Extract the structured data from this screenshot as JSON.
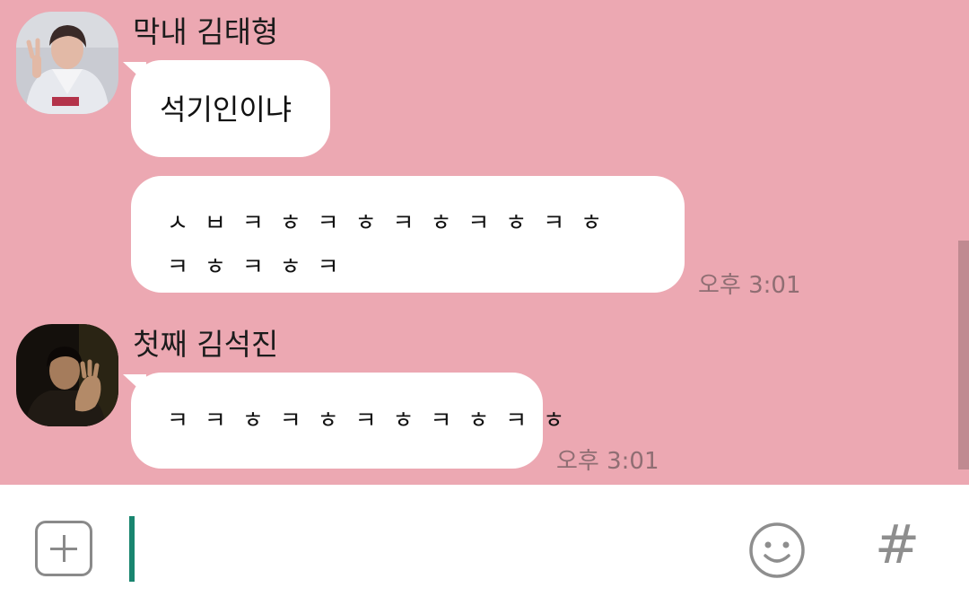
{
  "messages": [
    {
      "sender": "막내 김태형",
      "bubbles": [
        {
          "text": "석기인이냐"
        },
        {
          "text": "ㅅㅂㅋㅎㅋㅎㅋㅎㅋㅎㅋㅎㅋㅎㅋㅎㅋ",
          "time": "오후 3:01"
        }
      ]
    },
    {
      "sender": "첫째 김석진",
      "bubbles": [
        {
          "text": "ㅋㅋㅎㅋㅎㅋㅎㅋㅎㅋㅎ",
          "time": "오후 3:01"
        }
      ]
    }
  ],
  "input": {
    "value": "",
    "placeholder": ""
  },
  "icons": {
    "add": "plus-box-icon",
    "emoji": "smiley-icon",
    "hashtag": "#"
  },
  "colors": {
    "chat_background": "#eca8b2",
    "bubble": "#ffffff",
    "cursor": "#19856f",
    "timestamp": "#8f6e73"
  }
}
